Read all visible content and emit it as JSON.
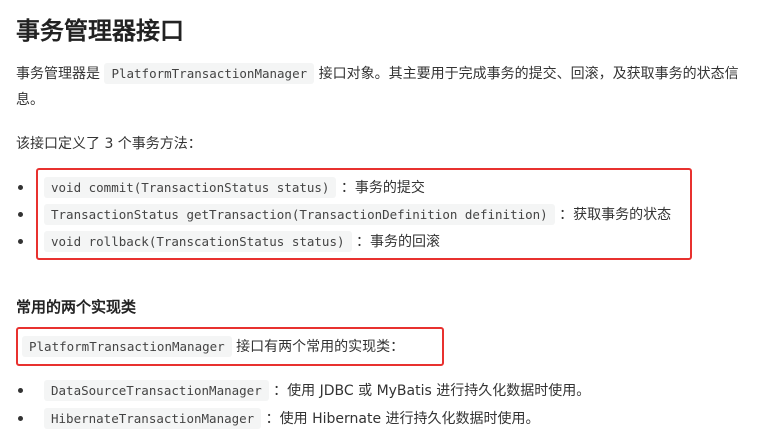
{
  "page": {
    "title": "事务管理器接口",
    "intro": {
      "prefix": "事务管理器是",
      "code": "PlatformTransactionManager",
      "suffix": " 接口对象。其主要用于完成事务的提交、回滚，及获取事务的状态信息。"
    },
    "methods_intro": "该接口定义了 3 个事务方法：",
    "methods": [
      {
        "code": "void commit(TransactionStatus status)",
        "desc": "：事务的提交"
      },
      {
        "code": "TransactionStatus getTransaction(TransactionDefinition definition)",
        "desc": "：获取事务的状态"
      },
      {
        "code": "void rollback(TranscationStatus status)",
        "desc": "：事务的回滚"
      }
    ],
    "impl_section": {
      "title": "常用的两个实现类",
      "code": "PlatformTransactionManager",
      "text": " 接口有两个常用的实现类：",
      "items": [
        {
          "code": "DataSourceTransactionManager",
          "desc": "：使用 JDBC 或 MyBatis 进行持久化数据时使用。"
        },
        {
          "code": "HibernateTransactionManager",
          "desc": "：使用 Hibernate 进行持久化数据时使用。"
        }
      ]
    },
    "colors": {
      "highlight_border": "#e8312f",
      "code_background": "#f4f5f5",
      "text": "#333333"
    }
  }
}
